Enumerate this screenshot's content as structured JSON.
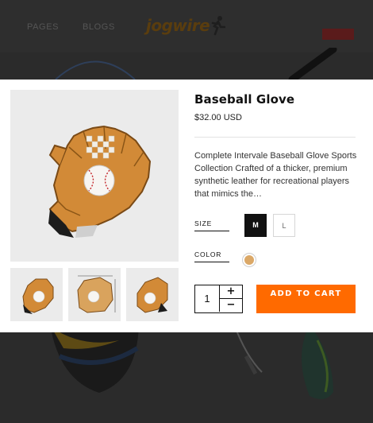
{
  "nav": {
    "pages": "PAGES",
    "blogs": "BLOGS"
  },
  "logo": {
    "text": "jogwire"
  },
  "product": {
    "title": "Baseball Glove",
    "price": "$32.00 USD",
    "description": "Complete Intervale Baseball Glove Sports Collection Crafted of a thicker, premium synthetic leather for recreational players that mimics the…"
  },
  "options": {
    "size_label": "SIZE",
    "sizes": [
      "M",
      "L"
    ],
    "selected_size": "M",
    "color_label": "COLOR",
    "swatch_color": "#dba867"
  },
  "quantity": {
    "value": "1",
    "plus": "+",
    "minus": "−"
  },
  "cart": {
    "add_label": "ADD TO CART"
  },
  "colors": {
    "accent": "#ff6a00",
    "selected_size_bg": "#111111"
  },
  "icons": [
    "runner-logo-icon",
    "plus-icon",
    "minus-icon"
  ]
}
